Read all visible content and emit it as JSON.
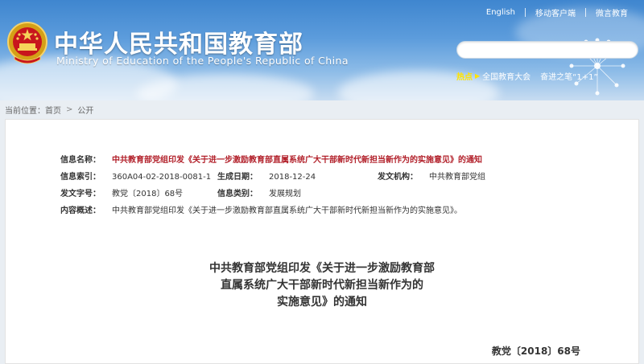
{
  "header": {
    "top_links": [
      "English",
      "移动客户端",
      "微言教育"
    ],
    "title_zh": "中华人民共和国教育部",
    "title_en": "Ministry of Education of the People's Republic of China",
    "search": {
      "placeholder": "",
      "value": ""
    },
    "hot": {
      "label": "热点",
      "items": [
        "全国教育大会",
        "奋进之笔“1+1”"
      ]
    }
  },
  "breadcrumb": {
    "prefix": "当前位置：",
    "items": [
      "首页",
      "公开"
    ],
    "separator": ">"
  },
  "meta": {
    "name_label": "信息名称：",
    "name_value": "中共教育部党组印发《关于进一步激励教育部直属系统广大干部新时代新担当新作为的实施意见》的通知",
    "index_label": "信息索引：",
    "index_value": "360A04-02-2018-0081-1",
    "date_label": "生成日期：",
    "date_value": "2018-12-24",
    "org_label": "发文机构：",
    "org_value": "中共教育部党组",
    "docno_label": "发文字号：",
    "docno_value": "教党〔2018〕68号",
    "category_label": "信息类别：",
    "category_value": "发展规划",
    "summary_label": "内容概述：",
    "summary_value": "中共教育部党组印发《关于进一步激励教育部直属系统广大干部新时代新担当新作为的实施意见》。"
  },
  "document": {
    "title_lines": [
      "中共教育部党组印发《关于进一步激励教育部",
      "直属系统广大干部新时代新担当新作为的",
      "实施意见》的通知"
    ],
    "doc_number": "教党〔2018〕68号"
  }
}
